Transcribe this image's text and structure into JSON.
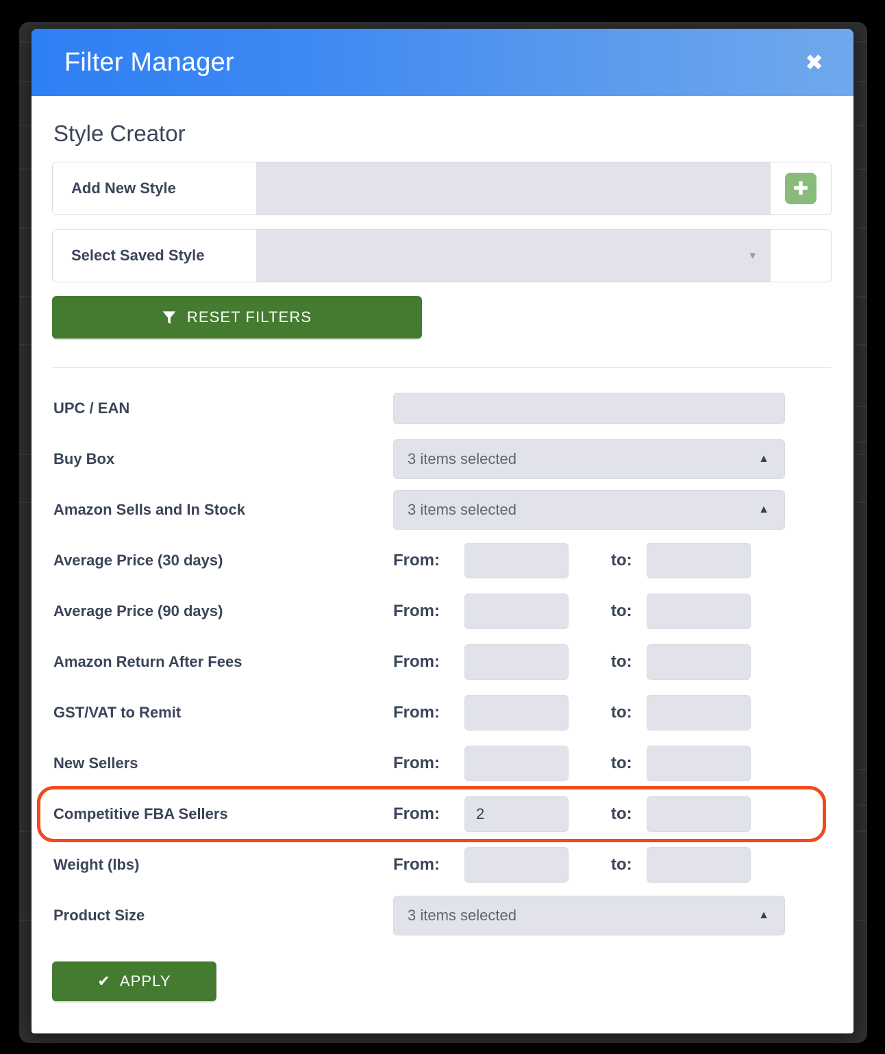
{
  "modal": {
    "title": "Filter Manager",
    "close_icon": "close-icon",
    "close_glyph": "✖"
  },
  "style_creator": {
    "heading": "Style Creator",
    "add_new_style": {
      "label": "Add New Style",
      "value": "",
      "placeholder": "",
      "add_icon": "plus-icon",
      "add_glyph": "✚"
    },
    "select_saved_style": {
      "label": "Select Saved Style",
      "value": "",
      "caret_icon": "chevron-down-icon",
      "caret_glyph": "▾"
    },
    "reset_button": {
      "label": "RESET FILTERS",
      "icon": "funnel-icon"
    }
  },
  "filters": [
    {
      "label": "UPC / EAN",
      "type": "text",
      "value": ""
    },
    {
      "label": "Buy Box",
      "type": "multiselect",
      "value": "3 items selected",
      "caret_glyph": "▲"
    },
    {
      "label": "Amazon Sells and In Stock",
      "type": "multiselect",
      "value": "3 items selected",
      "caret_glyph": "▲"
    },
    {
      "label": "Average Price (30 days)",
      "type": "range",
      "from_label": "From:",
      "to_label": "to:",
      "from_value": "",
      "to_value": ""
    },
    {
      "label": "Average Price (90 days)",
      "type": "range",
      "from_label": "From:",
      "to_label": "to:",
      "from_value": "",
      "to_value": ""
    },
    {
      "label": "Amazon Return After Fees",
      "type": "range",
      "from_label": "From:",
      "to_label": "to:",
      "from_value": "",
      "to_value": ""
    },
    {
      "label": "GST/VAT to Remit",
      "type": "range",
      "from_label": "From:",
      "to_label": "to:",
      "from_value": "",
      "to_value": ""
    },
    {
      "label": "New Sellers",
      "type": "range",
      "from_label": "From:",
      "to_label": "to:",
      "from_value": "",
      "to_value": ""
    },
    {
      "label": "Competitive FBA Sellers",
      "type": "range",
      "from_label": "From:",
      "to_label": "to:",
      "from_value": "2",
      "to_value": "",
      "highlighted": true
    },
    {
      "label": "Weight (lbs)",
      "type": "range",
      "from_label": "From:",
      "to_label": "to:",
      "from_value": "",
      "to_value": ""
    },
    {
      "label": "Product Size",
      "type": "multiselect",
      "value": "3 items selected",
      "caret_glyph": "▲"
    }
  ],
  "apply_button": {
    "label": "APPLY",
    "icon": "check-icon",
    "glyph": "✔"
  },
  "annotation": {
    "name": "highlight-box",
    "color": "#f04a21",
    "target_row": "Competitive FBA Sellers"
  },
  "colors": {
    "header_gradient_start": "#2f80f5",
    "header_gradient_end": "#70a8ec",
    "input_background": "#e2e2ea",
    "label_text": "#3b4559",
    "primary_green": "#447b30",
    "light_green": "#89bb7d",
    "highlight_red": "#f04a21",
    "backdrop": "#000000"
  }
}
